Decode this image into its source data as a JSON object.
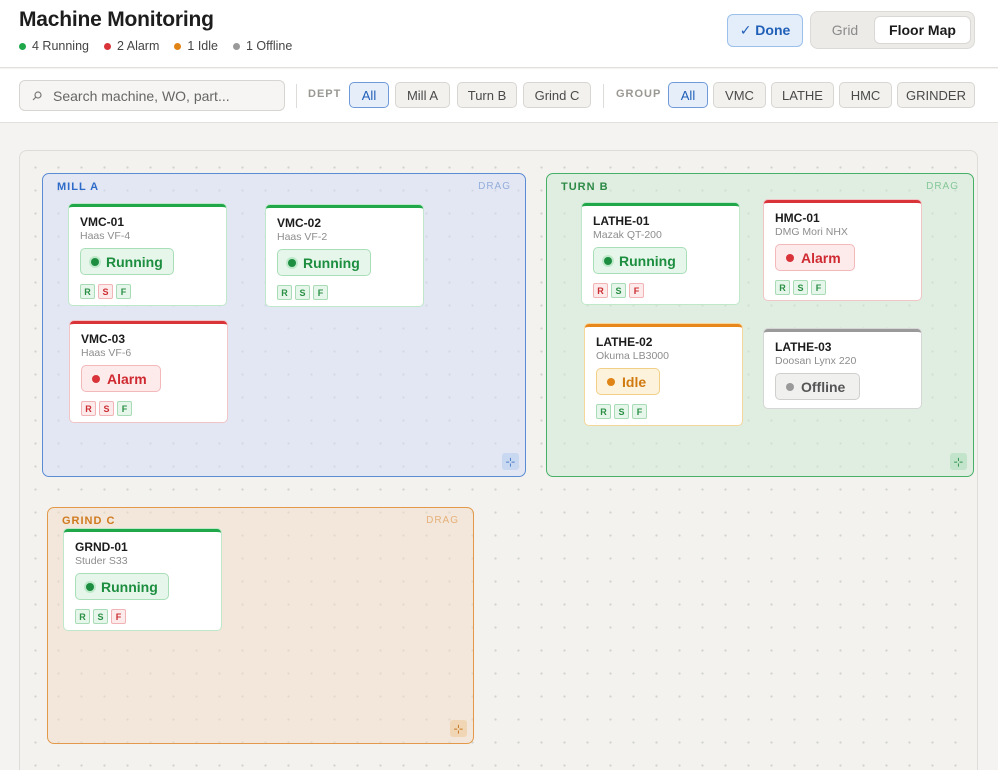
{
  "header": {
    "title": "Machine Monitoring",
    "summary": [
      {
        "label": "4 Running",
        "color": "#1fa74a"
      },
      {
        "label": "2 Alarm",
        "color": "#d8343a"
      },
      {
        "label": "1 Idle",
        "color": "#e08416"
      },
      {
        "label": "1 Offline",
        "color": "#9a9a9a"
      }
    ],
    "done_label": "✓ Done",
    "view_options": {
      "grid": "Grid",
      "floor": "Floor Map",
      "selected": "Floor Map"
    }
  },
  "toolbar": {
    "search": {
      "value": "",
      "placeholder": "Search machine, WO, part..."
    },
    "dept": {
      "label": "DEPT",
      "options": [
        "All",
        "Mill A",
        "Turn B",
        "Grind C"
      ],
      "selected": "All"
    },
    "group": {
      "label": "GROUP",
      "options": [
        "All",
        "VMC",
        "LATHE",
        "HMC",
        "GRINDER"
      ],
      "selected": "All"
    }
  },
  "zones": {
    "mill": {
      "name": "MILL A",
      "drag": "DRAG"
    },
    "turn": {
      "name": "TURN B",
      "drag": "DRAG"
    },
    "grind": {
      "name": "GRIND C",
      "drag": "DRAG"
    }
  },
  "badge_labels": {
    "r": "R",
    "s": "S",
    "f": "F"
  },
  "machines": {
    "vmc01": {
      "id": "VMC-01",
      "model": "Haas VF-4",
      "status": "Running",
      "status_key": "running",
      "badges": [
        "ok",
        "bad",
        "ok"
      ]
    },
    "vmc02": {
      "id": "VMC-02",
      "model": "Haas VF-2",
      "status": "Running",
      "status_key": "running",
      "badges": [
        "ok",
        "ok",
        "ok"
      ]
    },
    "vmc03": {
      "id": "VMC-03",
      "model": "Haas VF-6",
      "status": "Alarm",
      "status_key": "alarm",
      "badges": [
        "bad",
        "bad",
        "ok"
      ]
    },
    "lathe01": {
      "id": "LATHE-01",
      "model": "Mazak QT-200",
      "status": "Running",
      "status_key": "running",
      "badges": [
        "bad",
        "ok",
        "bad"
      ]
    },
    "hmc01": {
      "id": "HMC-01",
      "model": "DMG Mori NHX",
      "status": "Alarm",
      "status_key": "alarm",
      "badges": [
        "ok",
        "ok",
        "ok"
      ]
    },
    "lathe02": {
      "id": "LATHE-02",
      "model": "Okuma LB3000",
      "status": "Idle",
      "status_key": "idle",
      "badges": [
        "ok",
        "ok",
        "ok"
      ]
    },
    "lathe03": {
      "id": "LATHE-03",
      "model": "Doosan Lynx 220",
      "status": "Offline",
      "status_key": "offline",
      "badges": []
    },
    "grnd01": {
      "id": "GRND-01",
      "model": "Studer S33",
      "status": "Running",
      "status_key": "running",
      "badges": [
        "ok",
        "ok",
        "bad"
      ]
    }
  }
}
